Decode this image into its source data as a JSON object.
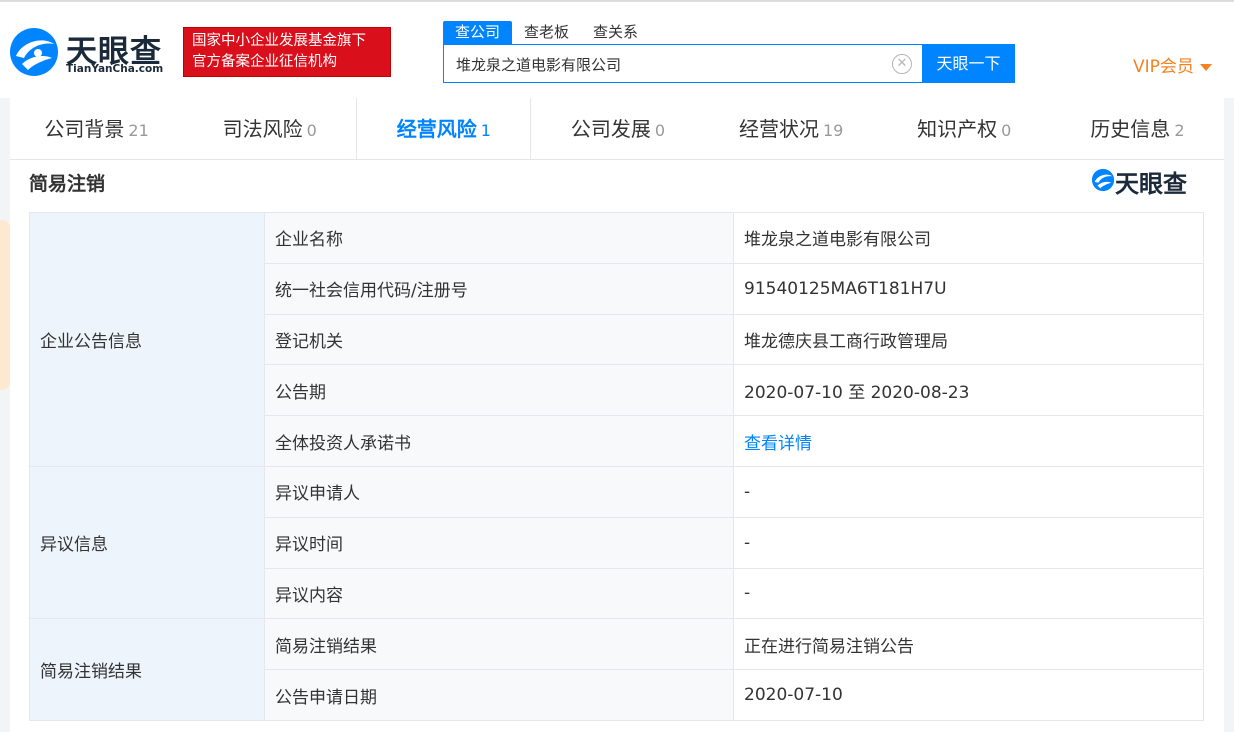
{
  "header": {
    "logo_text": "天眼查",
    "logo_sub": "TianYanCha.com",
    "badge_line1": "国家中小企业发展基金旗下",
    "badge_line2": "官方备案企业征信机构",
    "search_tabs": [
      {
        "label": "查公司",
        "active": true
      },
      {
        "label": "查老板",
        "active": false
      },
      {
        "label": "查关系",
        "active": false
      }
    ],
    "search_value": "堆龙泉之道电影有限公司",
    "search_button": "天眼一下",
    "vip_label": "VIP会员"
  },
  "nav": {
    "tabs": [
      {
        "label": "公司背景",
        "count": "21"
      },
      {
        "label": "司法风险",
        "count": "0"
      },
      {
        "label": "经营风险",
        "count": "1",
        "active": true
      },
      {
        "label": "公司发展",
        "count": "0"
      },
      {
        "label": "经营状况",
        "count": "19"
      },
      {
        "label": "知识产权",
        "count": "0"
      },
      {
        "label": "历史信息",
        "count": "2"
      }
    ]
  },
  "section": {
    "title": "简易注销",
    "watermark": "天眼查"
  },
  "table": {
    "groups": [
      "企业公告信息",
      "异议信息",
      "简易注销结果"
    ],
    "rows": [
      {
        "label": "企业名称",
        "value": "堆龙泉之道电影有限公司"
      },
      {
        "label": "统一社会信用代码/注册号",
        "value": "91540125MA6T181H7U"
      },
      {
        "label": "登记机关",
        "value": "堆龙德庆县工商行政管理局"
      },
      {
        "label": "公告期",
        "value": "2020-07-10 至 2020-08-23"
      },
      {
        "label": "全体投资人承诺书",
        "value": "查看详情"
      },
      {
        "label": "异议申请人",
        "value": "-"
      },
      {
        "label": "异议时间",
        "value": "-"
      },
      {
        "label": "异议内容",
        "value": "-"
      },
      {
        "label": "简易注销结果",
        "value": "正在进行简易注销公告"
      },
      {
        "label": "公告申请日期",
        "value": "2020-07-10"
      }
    ]
  },
  "colors": {
    "brand_blue": "#0084ff",
    "badge_red": "#d9101c",
    "vip_orange": "#f5821f"
  }
}
